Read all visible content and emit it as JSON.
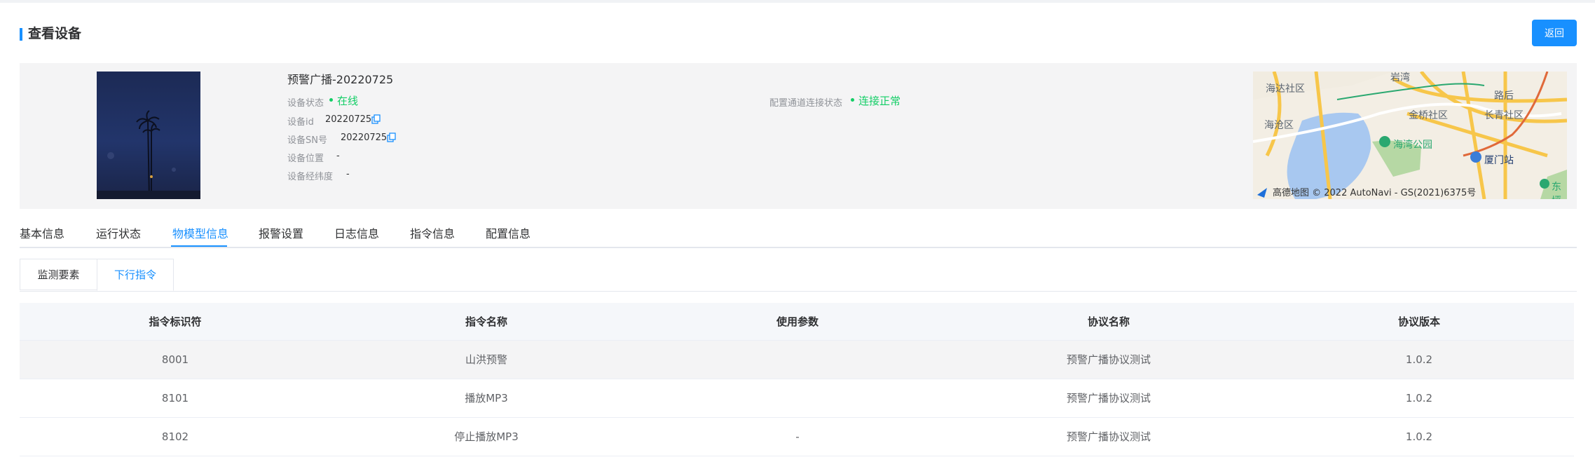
{
  "header": {
    "title": "查看设备",
    "back_label": "返回"
  },
  "device": {
    "name": "预警广播-20220725",
    "status_label": "设备状态",
    "status_value": "在线",
    "channel_label": "配置通道连接状态",
    "channel_value": "连接正常",
    "id_label": "设备id",
    "id_value": "20220725",
    "sn_label": "设备SN号",
    "sn_value": "20220725",
    "location_label": "设备位置",
    "location_value": "-",
    "coords_label": "设备经纬度",
    "coords_value": "-"
  },
  "map": {
    "labels": [
      "海达社区",
      "海沧区",
      "金桥社区",
      "长青社区",
      "海湾公园",
      "厦门站",
      "东坪",
      "岩湾",
      "路后"
    ],
    "credit": "高德地图 © 2022 AutoNavi - GS(2021)6375号"
  },
  "tabs": [
    "基本信息",
    "运行状态",
    "物模型信息",
    "报警设置",
    "日志信息",
    "指令信息",
    "配置信息"
  ],
  "active_tab": "物模型信息",
  "subtabs": [
    "监测要素",
    "下行指令"
  ],
  "active_subtab": "下行指令",
  "table": {
    "columns": [
      "指令标识符",
      "指令名称",
      "使用参数",
      "协议名称",
      "协议版本"
    ],
    "rows": [
      [
        "8001",
        "山洪预警",
        "",
        "预警广播协议测试",
        "1.0.2"
      ],
      [
        "8101",
        "播放MP3",
        "",
        "预警广播协议测试",
        "1.0.2"
      ],
      [
        "8102",
        "停止播放MP3",
        "-",
        "预警广播协议测试",
        "1.0.2"
      ]
    ]
  },
  "colors": {
    "accent": "#1890ff",
    "online": "#13ce66"
  }
}
